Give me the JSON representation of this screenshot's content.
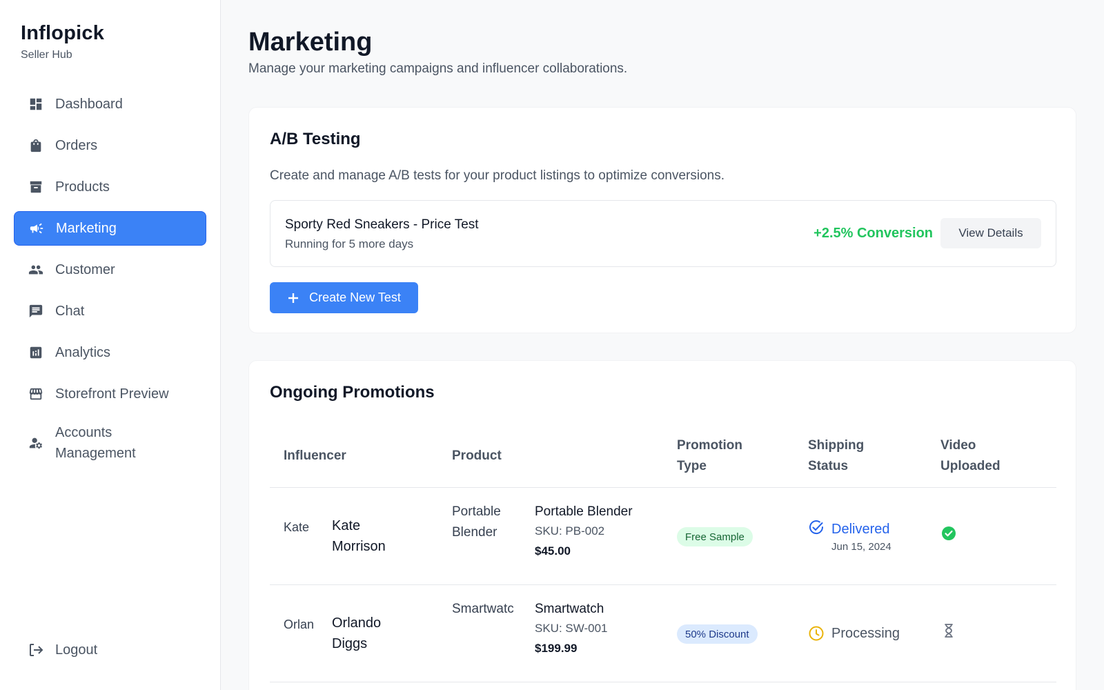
{
  "brand": {
    "title": "Inflopick",
    "subtitle": "Seller Hub"
  },
  "sidebar": {
    "items": [
      {
        "label": "Dashboard",
        "icon": "dashboard-icon"
      },
      {
        "label": "Orders",
        "icon": "shopping-bag-icon"
      },
      {
        "label": "Products",
        "icon": "archive-icon"
      },
      {
        "label": "Marketing",
        "icon": "megaphone-icon",
        "active": true
      },
      {
        "label": "Customer",
        "icon": "people-icon"
      },
      {
        "label": "Chat",
        "icon": "chat-icon"
      },
      {
        "label": "Analytics",
        "icon": "analytics-icon"
      },
      {
        "label": "Storefront Preview",
        "icon": "storefront-icon"
      },
      {
        "label": "Accounts Management",
        "icon": "manage-accounts-icon"
      }
    ],
    "logout_label": "Logout"
  },
  "header": {
    "title": "Marketing",
    "subtitle": "Manage your marketing campaigns and influencer collaborations."
  },
  "ab_testing": {
    "title": "A/B Testing",
    "description": "Create and manage A/B tests for your product listings to optimize conversions.",
    "test": {
      "name": "Sporty Red Sneakers - Price Test",
      "status": "Running for 5 more days",
      "result": "+2.5% Conversion",
      "view_label": "View Details"
    },
    "create_label": "Create New Test"
  },
  "promotions": {
    "title": "Ongoing Promotions",
    "columns": {
      "influencer": "Influencer",
      "product": "Product",
      "promotion_type_1": "Promotion",
      "promotion_type_2": "Type",
      "shipping_1": "Shipping",
      "shipping_2": "Status",
      "video_1": "Video",
      "video_2": "Uploaded"
    },
    "rows": [
      {
        "avatar_alt": "Kate",
        "influencer_first": "Kate",
        "influencer_last": "Morrison",
        "product_img_alt": "Portable Blender",
        "product_name": "Portable Blender",
        "sku": "SKU: PB-002",
        "price": "$45.00",
        "promo": "Free Sample",
        "shipping": "Delivered",
        "shipping_date": "Jun 15, 2024",
        "video": "uploaded"
      },
      {
        "avatar_alt": "Orlan",
        "influencer_first": "Orlando",
        "influencer_last": "Diggs",
        "product_img_alt": "Smartwatc",
        "product_name": "Smartwatch",
        "sku": "SKU: SW-001",
        "price": "$199.99",
        "promo": "50% Discount",
        "shipping": "Processing",
        "shipping_date": "",
        "video": "pending"
      }
    ]
  },
  "colors": {
    "accent": "#3b82f6",
    "success": "#22c55e",
    "delivered": "#2563eb",
    "processing": "#eab308"
  }
}
